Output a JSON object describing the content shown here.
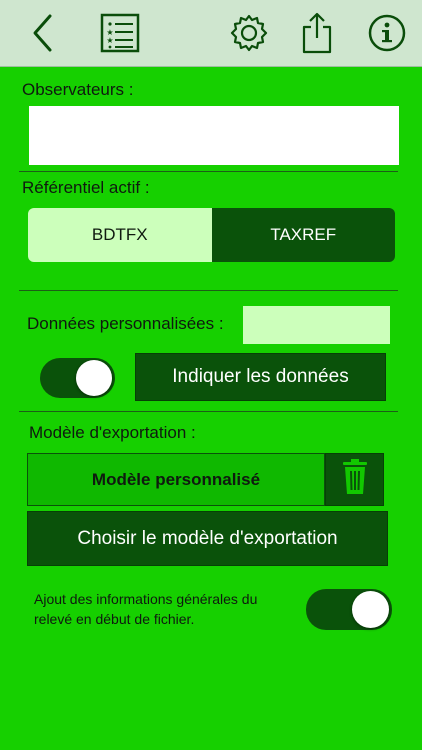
{
  "toolbar": {
    "icons": [
      "back-chevron-icon",
      "list-icon",
      "gear-icon",
      "share-icon",
      "info-icon"
    ]
  },
  "observers": {
    "label": "Observateurs :",
    "value": ""
  },
  "referential": {
    "label": "Référentiel actif :",
    "options": [
      "BDTFX",
      "TAXREF"
    ],
    "selected": "BDTFX"
  },
  "custom_data": {
    "label": "Données personnalisées :",
    "value": "",
    "toggle_on": true,
    "button_label": "Indiquer les données"
  },
  "export_model": {
    "label": "Modèle d'exportation :",
    "current_model": "Modèle personnalisé",
    "choose_button_label": "Choisir le modèle d'exportation"
  },
  "general_info": {
    "text": "Ajout des informations générales du relevé en début de fichier.",
    "toggle_on": true
  },
  "colors": {
    "background": "#16d000",
    "toolbar": "#cfe6cf",
    "dark_green": "#0a520a",
    "light_green": "#ccffbb"
  }
}
